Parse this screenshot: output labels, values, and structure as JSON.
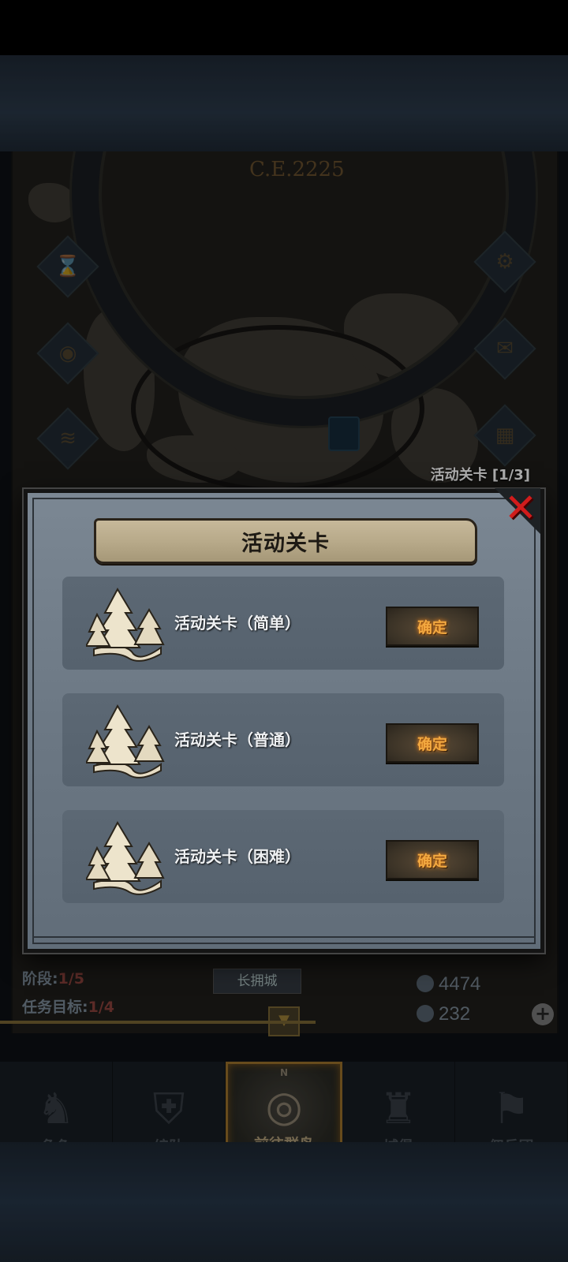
{
  "map": {
    "year": "C.E.2225",
    "side_icons": [
      "hourglass-icon",
      "money-bag-icon",
      "scroll-icon",
      "gear-icon",
      "mail-icon",
      "castle-gate-icon"
    ]
  },
  "event_counter": "活动关卡 [1/3]",
  "hud": {
    "stage_label": "阶段:",
    "stage_value": "1/5",
    "task_label": "任务目标:",
    "task_value": "1/4",
    "city": "长拥城",
    "silver": "4474",
    "crystal": "232",
    "plus": "+"
  },
  "modal": {
    "title": "活动关卡",
    "close": "✕",
    "rows": [
      {
        "label": "活动关卡（简单）",
        "button": "确定"
      },
      {
        "label": "活动关卡（普通）",
        "button": "确定"
      },
      {
        "label": "活动关卡（困难）",
        "button": "确定"
      }
    ]
  },
  "nav": {
    "compass_n": "N",
    "items": [
      {
        "label": "角色",
        "icon": "knight-helmet-icon",
        "active": false
      },
      {
        "label": "编队",
        "icon": "armor-icon",
        "active": false
      },
      {
        "label": "前往群岛",
        "icon": "compass-map-icon",
        "active": true
      },
      {
        "label": "城堡",
        "icon": "castle-icon",
        "active": false
      },
      {
        "label": "佣兵团",
        "icon": "banner-icon",
        "active": false
      }
    ]
  },
  "colors": {
    "accent_gold": "#8a6426",
    "confirm_text": "#f2a840",
    "close_red": "#d21c1c"
  }
}
